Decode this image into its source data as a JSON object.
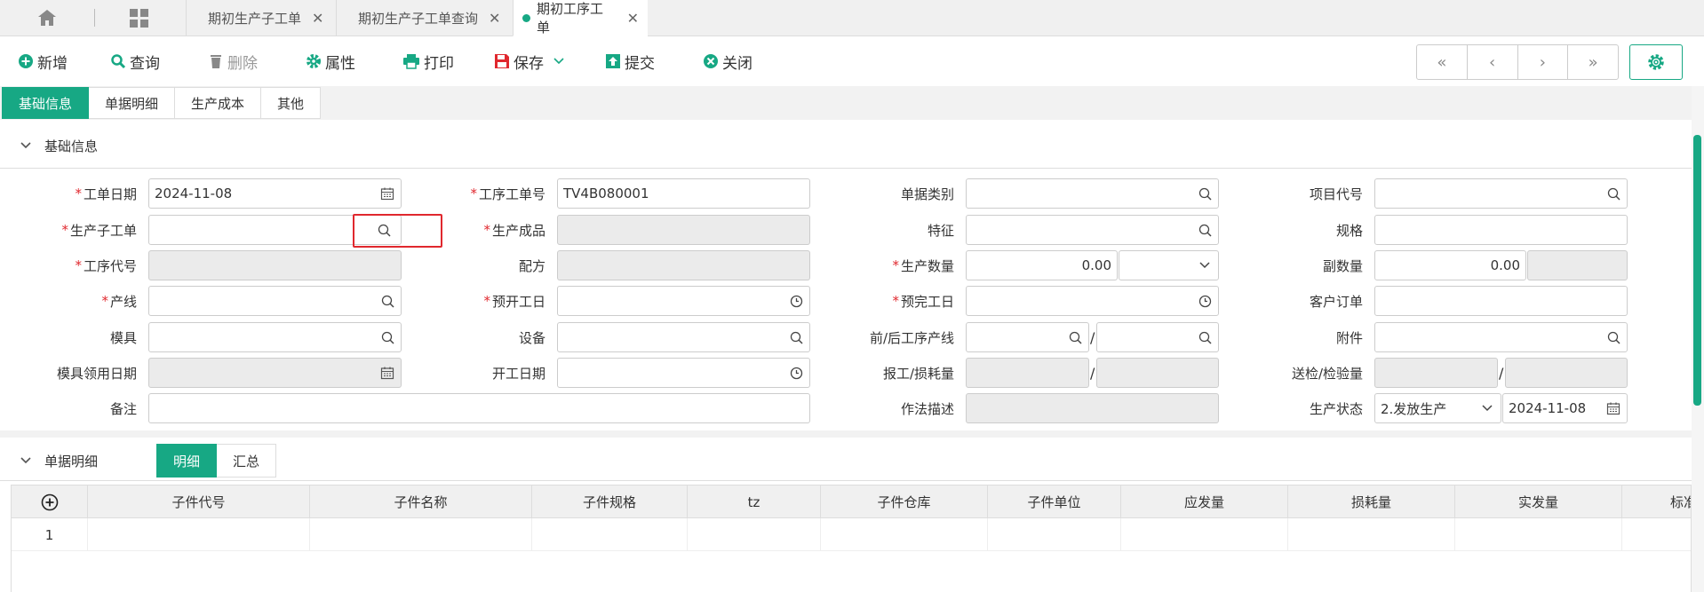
{
  "tabs": [
    {
      "label": "期初生产子工单"
    },
    {
      "label": "期初生产子工单查询"
    },
    {
      "label": "期初工序工单"
    }
  ],
  "toolbar": {
    "new": "新增",
    "query": "查询",
    "delete": "删除",
    "props": "属性",
    "print": "打印",
    "save": "保存",
    "submit": "提交",
    "close": "关闭"
  },
  "subtabs": [
    "基础信息",
    "单据明细",
    "生产成本",
    "其他"
  ],
  "basic": {
    "title": "基础信息",
    "work_date_label": "工单日期",
    "work_date": "2024-11-08",
    "process_no_label": "工序工单号",
    "process_no": "TV4B080001",
    "doc_type_label": "单据类别",
    "project_label": "项目代号",
    "sub_order_label": "生产子工单",
    "product_label": "生产成品",
    "feature_label": "特征",
    "spec_label": "规格",
    "process_code_label": "工序代号",
    "formula_label": "配方",
    "qty_label": "生产数量",
    "qty": "0.00",
    "sub_qty_label": "副数量",
    "sub_qty": "0.00",
    "line_label": "产线",
    "plan_start_label": "预开工日",
    "plan_end_label": "预完工日",
    "customer_order_label": "客户订单",
    "mold_label": "模具",
    "equipment_label": "设备",
    "prev_next_label": "前/后工序产线",
    "attach_label": "附件",
    "mold_date_label": "模具领用日期",
    "start_date_label": "开工日期",
    "report_loss_label": "报工/损耗量",
    "inspect_label": "送检/检验量",
    "remark_label": "备注",
    "method_label": "作法描述",
    "status_label": "生产状态",
    "status": "2.发放生产",
    "status_date": "2024-11-08",
    "slash": "/"
  },
  "detail": {
    "title": "单据明细",
    "tab_detail": "明细",
    "tab_summary": "汇总",
    "columns": [
      "子件代号",
      "子件名称",
      "子件规格",
      "tz",
      "子件仓库",
      "子件单位",
      "应发量",
      "损耗量",
      "实发量",
      "标准"
    ],
    "rows": [
      {
        "no": "1"
      }
    ]
  },
  "colors": {
    "accent": "#17a884",
    "required": "#e0282e"
  }
}
